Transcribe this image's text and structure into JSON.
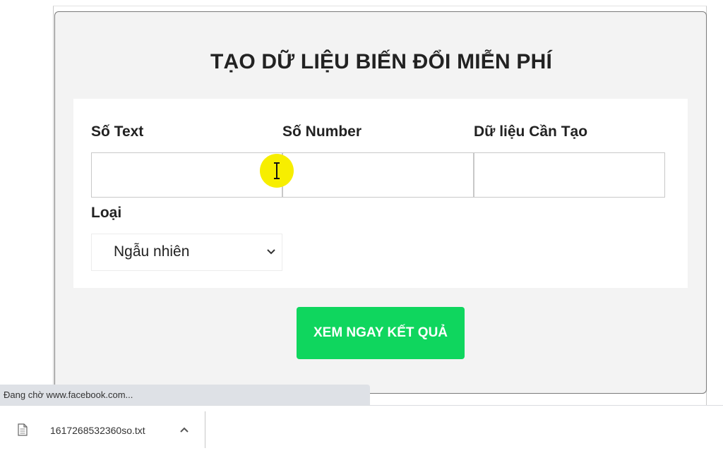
{
  "card": {
    "title": "TẠO DỮ LIỆU BIẾN ĐỔI MIỄN PHÍ"
  },
  "form": {
    "text_count": {
      "label": "Số Text",
      "value": "",
      "placeholder": ""
    },
    "number_count": {
      "label": "Số Number",
      "value": "",
      "placeholder": ""
    },
    "data_to_create": {
      "label": "Dữ liệu Cần Tạo",
      "value": "",
      "placeholder": ""
    },
    "type": {
      "label": "Loại",
      "selected": "Ngẫu nhiên"
    }
  },
  "submit_button": {
    "label": "XEM NGAY KẾT QUẢ"
  },
  "status_bar": {
    "text": "Đang chờ www.facebook.com..."
  },
  "download_bar": {
    "file_name": "1617268532360so.txt"
  },
  "icons": {
    "select_chevron": "chevron-down-icon",
    "cursor": "text-cursor-icon",
    "file": "file-icon",
    "download_menu": "chevron-up-icon"
  },
  "colors": {
    "accent_button": "#0fd65e",
    "cursor_highlight": "#f7ee00",
    "card_background": "#f3f3f3",
    "title_text": "#222222"
  }
}
